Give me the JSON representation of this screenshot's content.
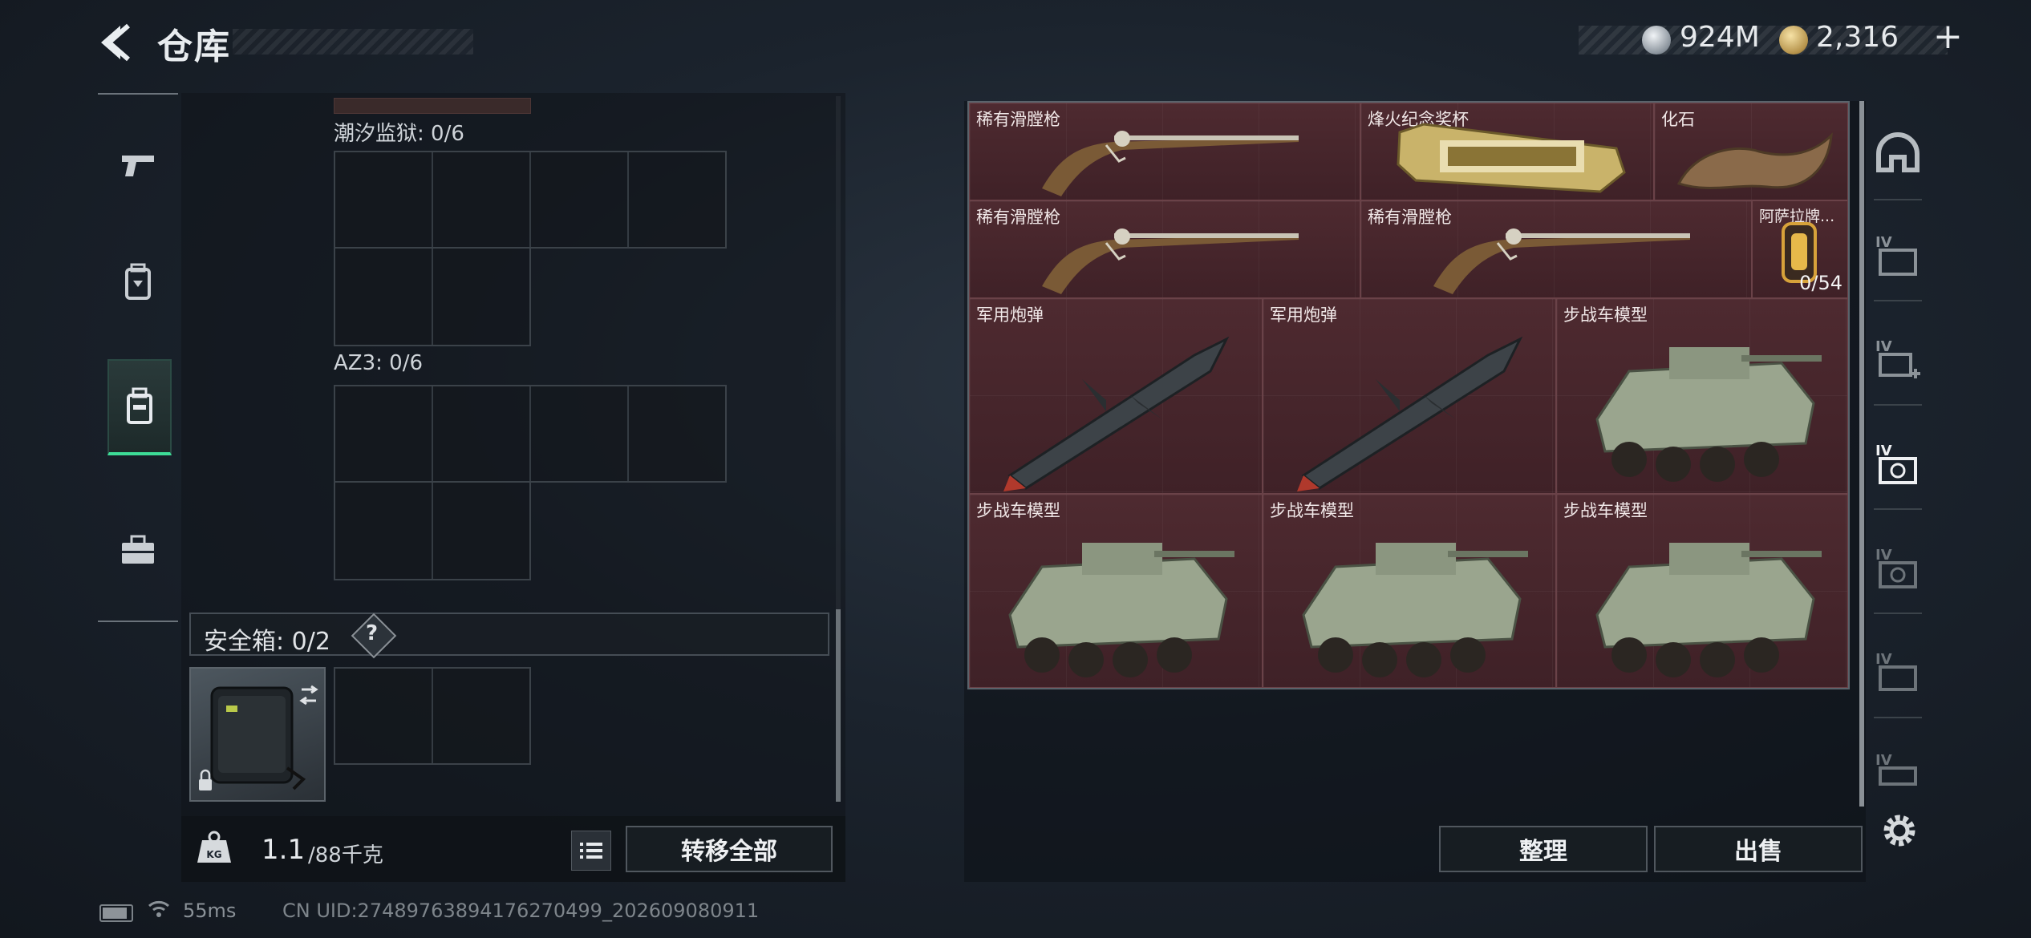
{
  "header": {
    "title": "仓库"
  },
  "currency": {
    "silver": "924M",
    "gold": "2,316",
    "add_label": "+"
  },
  "left_nav": {
    "items": [
      "pistol-icon",
      "backpack-icon",
      "safebox-icon",
      "toolbox-icon"
    ],
    "active_index": 2
  },
  "containers": [
    {
      "label": "潮汐监狱: 0/6"
    },
    {
      "label": "AZ3: 0/6"
    }
  ],
  "safebox": {
    "label": "安全箱: 0/2",
    "help": "?"
  },
  "weight": {
    "current": "1.1",
    "max": "/88千克"
  },
  "buttons": {
    "transfer_all": "转移全部",
    "organize": "整理",
    "sell": "出售"
  },
  "stash_items": [
    {
      "name": "稀有滑膛枪",
      "icon": "musket"
    },
    {
      "name": "烽火纪念奖杯",
      "icon": "trophy"
    },
    {
      "name": "化石",
      "icon": "fossil-claw"
    },
    {
      "name": "稀有滑膛枪",
      "icon": "musket"
    },
    {
      "name": "稀有滑膛枪",
      "icon": "musket"
    },
    {
      "name": "阿萨拉牌...",
      "icon": "card",
      "count": "0/54"
    },
    {
      "name": "军用炮弹",
      "icon": "missile"
    },
    {
      "name": "军用炮弹",
      "icon": "missile"
    },
    {
      "name": "步战车模型",
      "icon": "ifv-model"
    },
    {
      "name": "步战车模型",
      "icon": "ifv-model"
    },
    {
      "name": "步战车模型",
      "icon": "ifv-model"
    },
    {
      "name": "步战车模型",
      "icon": "ifv-model"
    }
  ],
  "right_nav": {
    "items": [
      "helmet-icon",
      "IV",
      "IV",
      "IV",
      "IV",
      "IV",
      "IV"
    ]
  },
  "status": {
    "ping": "55ms",
    "uid": "CN UID:27489763894176270499_202609080911"
  },
  "colors": {
    "accent": "#3ddc97",
    "rarity_red": "#4e2a30"
  }
}
